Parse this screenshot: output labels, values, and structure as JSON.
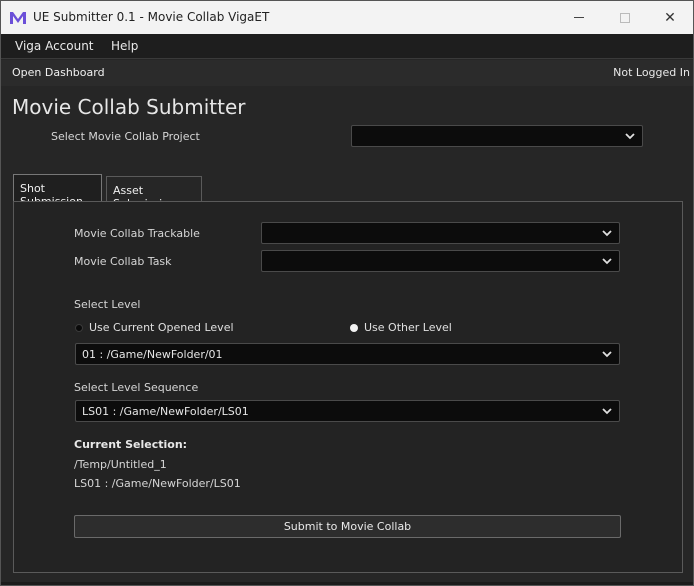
{
  "window": {
    "title": "UE Submitter 0.1 - Movie Collab VigaET",
    "logo_icon": "app-logo-icon",
    "controls": {
      "minimize": "minimize-icon",
      "maximize": "maximize-icon",
      "close": "✕"
    }
  },
  "menu": {
    "items": [
      {
        "label": "Viga Account"
      },
      {
        "label": "Help"
      }
    ]
  },
  "status": {
    "open_dashboard": "Open Dashboard",
    "login_status": "Not Logged In"
  },
  "page": {
    "title": "Movie Collab Submitter",
    "project_label": "Select Movie Collab Project",
    "project_value": ""
  },
  "tabs": [
    {
      "label": "Shot Submission",
      "active": true
    },
    {
      "label": "Asset Submission",
      "active": false
    }
  ],
  "shot": {
    "trackable_label": "Movie Collab Trackable",
    "trackable_value": "",
    "task_label": "Movie Collab Task",
    "task_value": "",
    "select_level_label": "Select Level",
    "radio_current": "Use Current Opened Level",
    "radio_other": "Use Other Level",
    "radio_selected": "Use Other Level",
    "level_value": "01 : /Game/NewFolder/01",
    "sequence_label": "Select Level Sequence",
    "sequence_value": "LS01 : /Game/NewFolder/LS01",
    "current_selection_title": "Current Selection:",
    "current_selection_lines": [
      "/Temp/Untitled_1",
      "LS01 : /Game/NewFolder/LS01"
    ],
    "submit_label": "Submit to Movie Collab"
  },
  "colors": {
    "accent_logo": "#6b4fd8",
    "background": "#262626",
    "combo_bg": "#0c0c0c"
  }
}
